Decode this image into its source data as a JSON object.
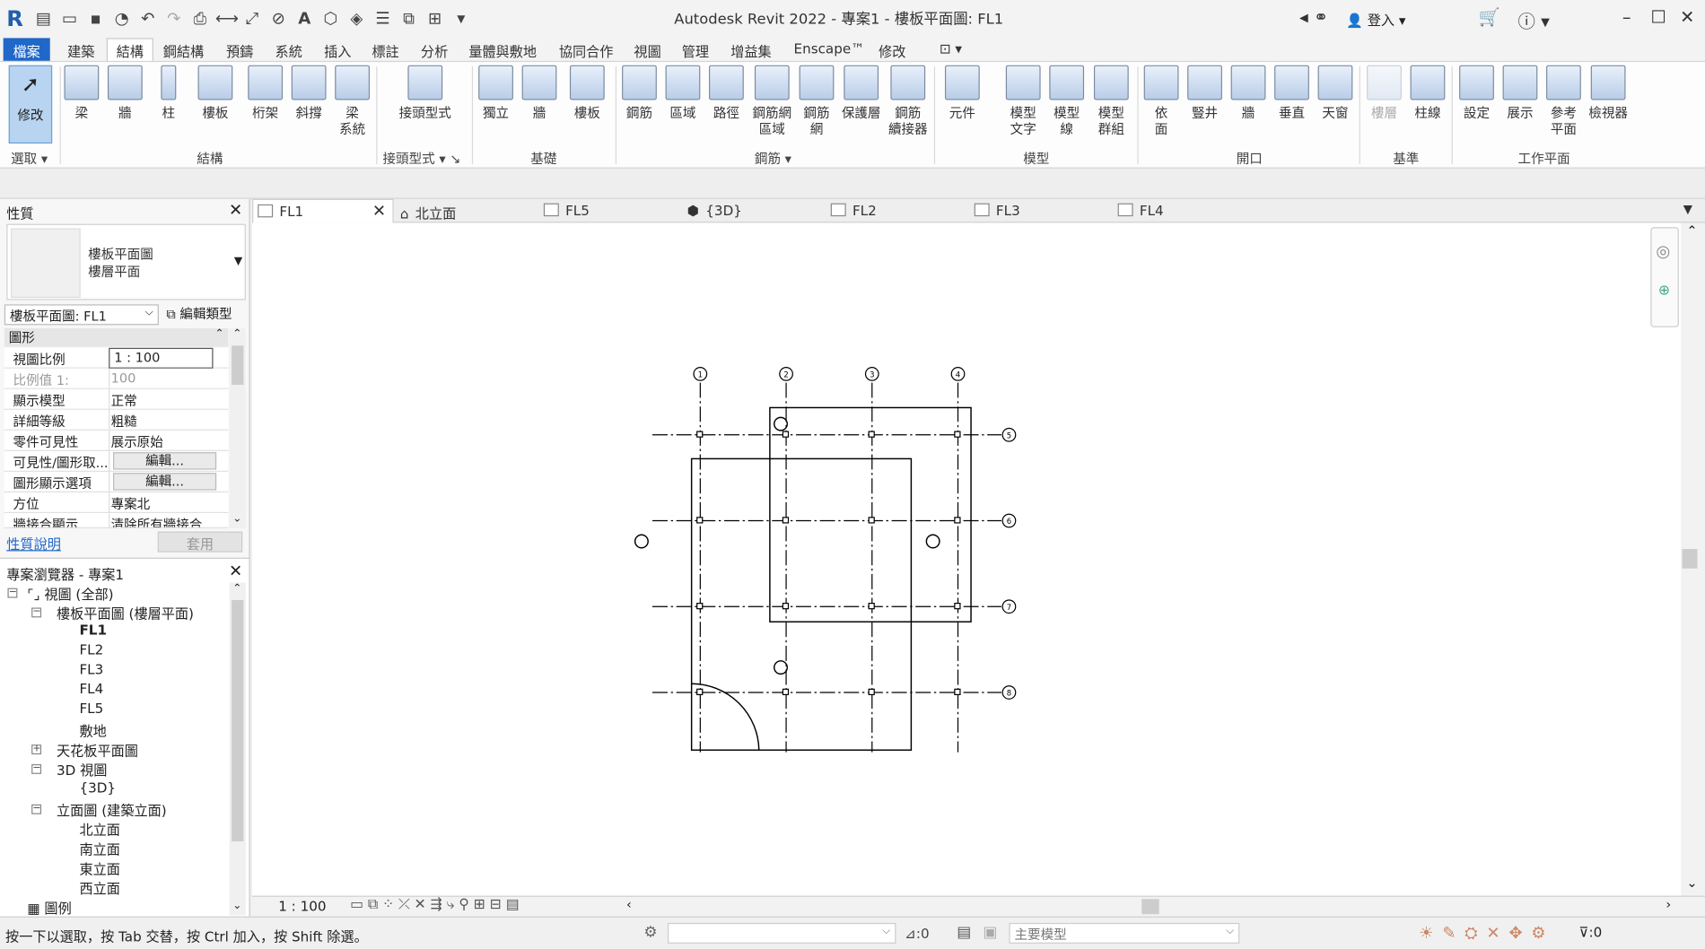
{
  "app": {
    "title": "Autodesk Revit 2022 - 專案1 - 樓板平面圖: FL1",
    "signin": "登入"
  },
  "menu": {
    "tabs": [
      "檔案",
      "建築",
      "結構",
      "鋼結構",
      "預鑄",
      "系統",
      "插入",
      "標註",
      "分析",
      "量體與敷地",
      "協同合作",
      "視圖",
      "管理",
      "增益集",
      "Enscape™",
      "修改"
    ],
    "active": "結構"
  },
  "ribbon": {
    "select": {
      "label": "修改",
      "panel": "選取"
    },
    "structure": {
      "buttons": [
        "梁",
        "牆",
        "柱",
        "樓板",
        "桁架",
        "斜撐",
        "梁\n系統"
      ],
      "panel": "結構"
    },
    "connection": {
      "buttons": [
        "接頭型式"
      ],
      "panel": "接頭型式"
    },
    "foundation": {
      "buttons": [
        "獨立",
        "牆",
        "樓板"
      ],
      "panel": "基礎"
    },
    "rebar": {
      "buttons": [
        "鋼筋",
        "區域",
        "路徑",
        "鋼筋網\n區域",
        "鋼筋\n網",
        "保護層",
        "鋼筋\n續接器"
      ],
      "panel": "鋼筋"
    },
    "model": {
      "buttons": [
        "元件",
        "模型\n文字",
        "模型\n線",
        "模型\n群組"
      ],
      "panel": "模型"
    },
    "opening": {
      "buttons": [
        "依\n面",
        "豎井",
        "牆",
        "垂直",
        "天窗"
      ],
      "panel": "開口"
    },
    "datum": {
      "buttons": [
        "樓層",
        "柱線"
      ],
      "panel": "基準"
    },
    "workplane": {
      "buttons": [
        "設定",
        "展示",
        "參考\n平面",
        "檢視器"
      ],
      "panel": "工作平面"
    }
  },
  "properties": {
    "title": "性質",
    "type_line1": "樓板平面圖",
    "type_line2": "樓層平面",
    "view_selector": "樓板平面圖: FL1",
    "edit_type": "編輯類型",
    "group": "圖形",
    "rows": [
      {
        "k": "視圖比例",
        "v": "1 : 100"
      },
      {
        "k": "比例值 1:",
        "v": "100"
      },
      {
        "k": "顯示模型",
        "v": "正常"
      },
      {
        "k": "詳細等級",
        "v": "粗糙"
      },
      {
        "k": "零件可見性",
        "v": "展示原始"
      },
      {
        "k": "可見性/圖形取...",
        "v": "編輯..."
      },
      {
        "k": "圖形顯示選項",
        "v": "編輯..."
      },
      {
        "k": "方位",
        "v": "專案北"
      },
      {
        "k": "牆接合顯示",
        "v": "清除所有牆接合"
      }
    ],
    "help": "性質說明",
    "apply": "套用"
  },
  "browser": {
    "title": "專案瀏覽器 - 專案1",
    "items": [
      "視圖 (全部)",
      "樓板平面圖 (樓層平面)",
      "FL1",
      "FL2",
      "FL3",
      "FL4",
      "FL5",
      "敷地",
      "天花板平面圖",
      "3D 視圖",
      "{3D}",
      "立面圖 (建築立面)",
      "北立面",
      "南立面",
      "東立面",
      "西立面",
      "圖例"
    ]
  },
  "view_tabs": [
    "FL1",
    "北立面",
    "FL5",
    "{3D}",
    "FL2",
    "FL3",
    "FL4"
  ],
  "plan": {
    "grid_top": [
      "1",
      "2",
      "3",
      "4"
    ],
    "grid_right": [
      "5",
      "6",
      "7",
      "8"
    ]
  },
  "viewbar": {
    "scale": "1 : 100"
  },
  "status": {
    "hint": "按一下以選取，按 Tab 交替，按 Ctrl 加入，按 Shift 除選。",
    "count": ":0",
    "workset": "主要模型",
    "filter": ":0"
  }
}
